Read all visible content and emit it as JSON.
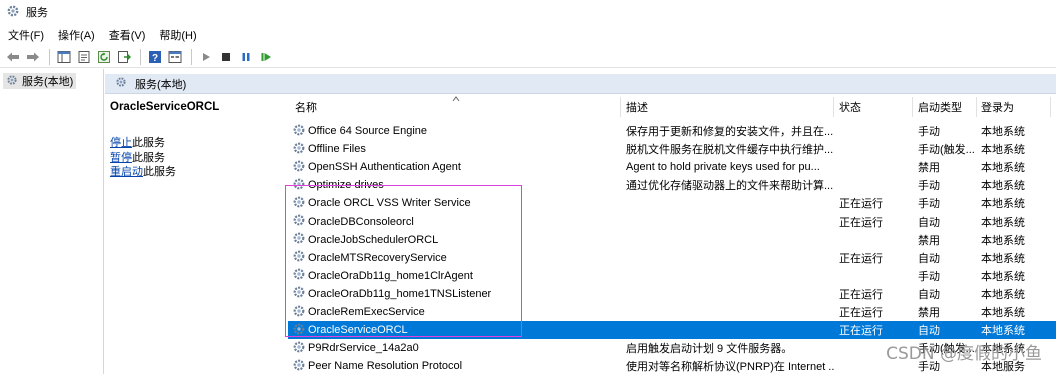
{
  "window": {
    "title": "服务",
    "icon": "gear-services-icon"
  },
  "menu": [
    {
      "label": "文件(F)"
    },
    {
      "label": "操作(A)"
    },
    {
      "label": "查看(V)"
    },
    {
      "label": "帮助(H)"
    }
  ],
  "toolbar": {
    "icons": [
      "back-arrow-icon",
      "forward-arrow-icon",
      "console-tree-icon",
      "properties-icon",
      "refresh-icon",
      "export-list-icon",
      "help-icon",
      "view-icon",
      "play-icon",
      "stop-icon",
      "pause-icon",
      "restart-icon"
    ]
  },
  "tree": {
    "label": "服务(本地)"
  },
  "pane_header": {
    "label": "服务(本地)"
  },
  "selected_service": {
    "name": "OracleServiceORCL",
    "actions": [
      {
        "link": "停止",
        "rest": "此服务"
      },
      {
        "link": "暂停",
        "rest": "此服务"
      },
      {
        "link": "重启动",
        "rest": "此服务"
      }
    ]
  },
  "columns": [
    "名称",
    "描述",
    "状态",
    "启动类型",
    "登录为"
  ],
  "rows": [
    {
      "name": "Office 64 Source Engine",
      "description": "保存用于更新和修复的安装文件，并且在...",
      "status": "",
      "startup": "手动",
      "logon": "本地系统"
    },
    {
      "name": "Offline Files",
      "description": "脱机文件服务在脱机文件缓存中执行维护...",
      "status": "",
      "startup": "手动(触发...",
      "logon": "本地系统"
    },
    {
      "name": "OpenSSH Authentication Agent",
      "description": "Agent to hold private keys used for pu...",
      "status": "",
      "startup": "禁用",
      "logon": "本地系统"
    },
    {
      "name": "Optimize drives",
      "description": "通过优化存储驱动器上的文件来帮助计算...",
      "status": "",
      "startup": "手动",
      "logon": "本地系统"
    },
    {
      "name": "Oracle ORCL VSS Writer Service",
      "description": "",
      "status": "正在运行",
      "startup": "手动",
      "logon": "本地系统"
    },
    {
      "name": "OracleDBConsoleorcl",
      "description": "",
      "status": "正在运行",
      "startup": "自动",
      "logon": "本地系统"
    },
    {
      "name": "OracleJobSchedulerORCL",
      "description": "",
      "status": "",
      "startup": "禁用",
      "logon": "本地系统"
    },
    {
      "name": "OracleMTSRecoveryService",
      "description": "",
      "status": "正在运行",
      "startup": "自动",
      "logon": "本地系统"
    },
    {
      "name": "OracleOraDb11g_home1ClrAgent",
      "description": "",
      "status": "",
      "startup": "手动",
      "logon": "本地系统"
    },
    {
      "name": "OracleOraDb11g_home1TNSListener",
      "description": "",
      "status": "正在运行",
      "startup": "自动",
      "logon": "本地系统"
    },
    {
      "name": "OracleRemExecService",
      "description": "",
      "status": "正在运行",
      "startup": "禁用",
      "logon": "本地系统"
    },
    {
      "name": "OracleServiceORCL",
      "description": "",
      "status": "正在运行",
      "startup": "自动",
      "logon": "本地系统",
      "selected": true
    },
    {
      "name": "P9RdrService_14a2a0",
      "description": "启用触发启动计划 9 文件服务器。",
      "status": "",
      "startup": "手动(触发...",
      "logon": "本地系统"
    },
    {
      "name": "Peer Name Resolution Protocol",
      "description": "使用对等名称解析协议(PNRP)在 Internet ...",
      "status": "",
      "startup": "手动",
      "logon": "本地服务"
    }
  ],
  "watermark": "CSDN @度假的小鱼",
  "colors": {
    "selection": "#0078d7",
    "highlight_box": "#e040e0",
    "pane_header": "#e1e9f4",
    "link": "#0645ad"
  }
}
